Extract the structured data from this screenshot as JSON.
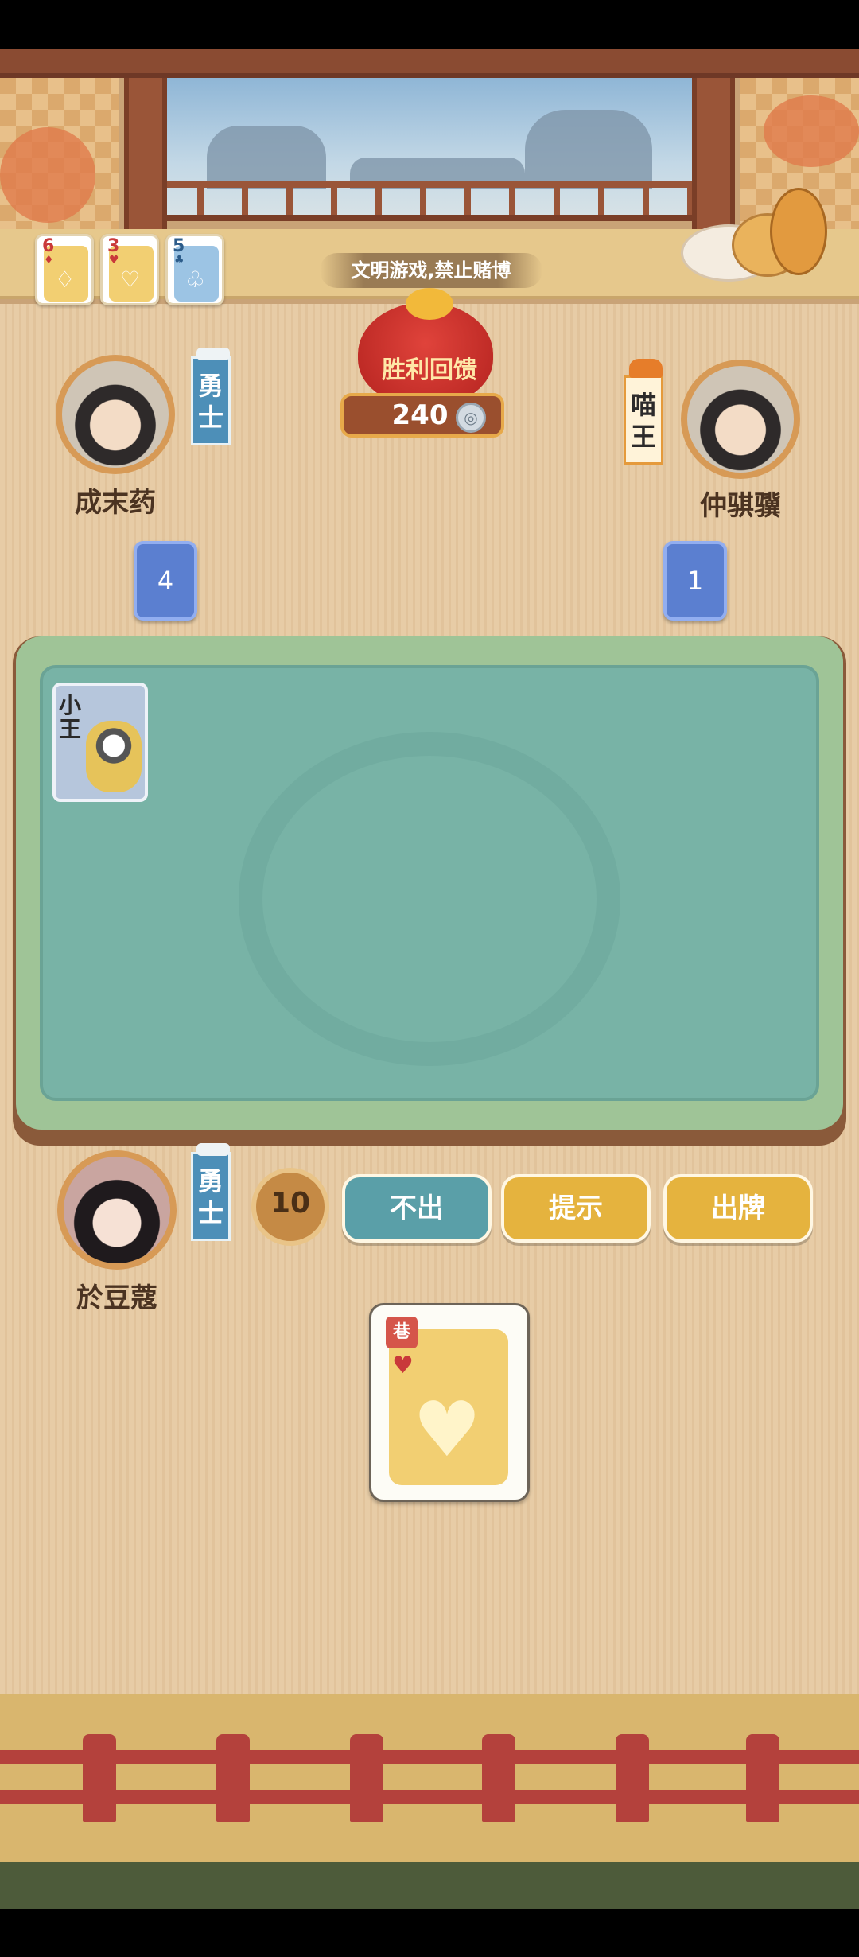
{
  "notice": "文明游戏,禁止赌博",
  "recent_cards": [
    {
      "rank": "6",
      "suit": "♦",
      "suit_color": "#c9393a",
      "face_color": "#f2cf72",
      "icon": "♢"
    },
    {
      "rank": "3",
      "suit": "♥",
      "suit_color": "#c9393a",
      "face_color": "#f2cf72",
      "icon": "♡"
    },
    {
      "rank": "5",
      "suit": "♣",
      "suit_color": "#2c5c8a",
      "face_color": "#9cc4e4",
      "icon": "♧"
    }
  ],
  "prize": {
    "label": "胜利回馈",
    "amount": "240"
  },
  "players": {
    "left": {
      "name": "成末药",
      "rank": "勇士",
      "cards_left": "4"
    },
    "right": {
      "name": "仲骐骥",
      "rank": "喵王",
      "cards_left": "1"
    },
    "self": {
      "name": "於豆蔻",
      "rank": "勇士"
    }
  },
  "table": {
    "played_card": {
      "label": "小王"
    }
  },
  "controls": {
    "timer": "10",
    "pass_label": "不出",
    "hint_label": "提示",
    "play_label": "出牌"
  },
  "hand": {
    "rank": "巷",
    "suit": "♥",
    "big_suit": "♥"
  },
  "colors": {
    "background": "#e7cca6",
    "felt": "#78b3a6",
    "pass_button": "#5a9fa8",
    "action_button": "#e5b33e",
    "card_count": "#5b7fd0"
  }
}
